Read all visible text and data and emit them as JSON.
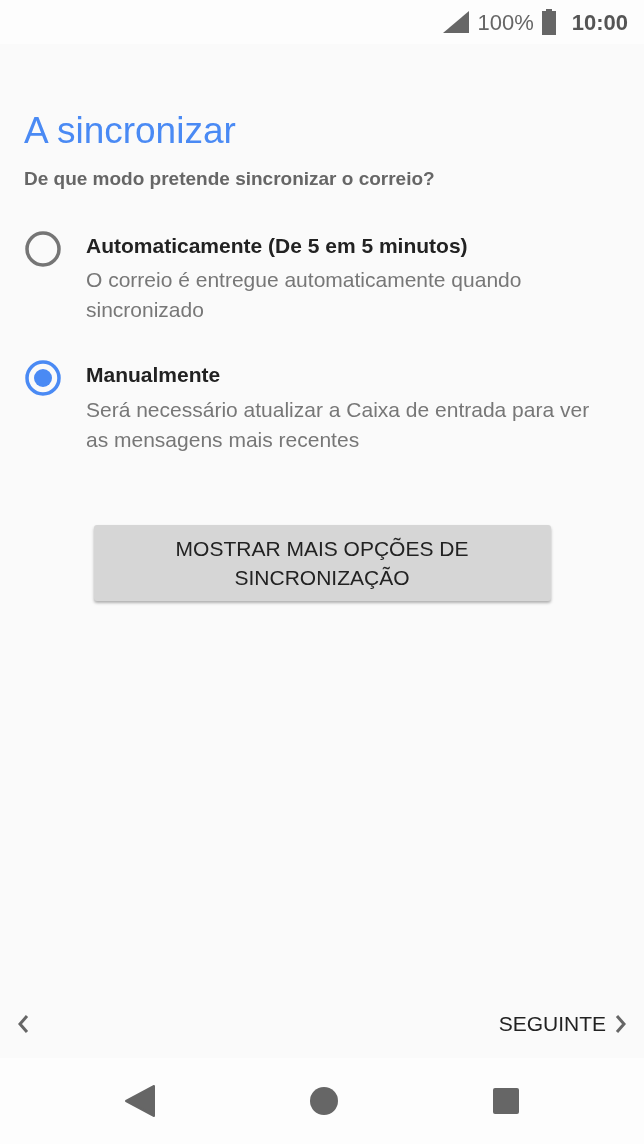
{
  "status_bar": {
    "battery": "100%",
    "time": "10:00"
  },
  "title": "A sincronizar",
  "subtitle": "De que modo pretende sincronizar o correio?",
  "options": [
    {
      "label": "Automaticamente (De 5 em 5 minutos)",
      "description": "O correio é entregue automaticamente quando sincronizado",
      "selected": false
    },
    {
      "label": "Manualmente",
      "description": "Será necessário atualizar a Caixa de entrada para ver as mensagens mais recentes",
      "selected": true
    }
  ],
  "more_button": "MOSTRAR MAIS OPÇÕES DE SINCRONIZAÇÃO",
  "footer": {
    "next": "SEGUINTE"
  }
}
